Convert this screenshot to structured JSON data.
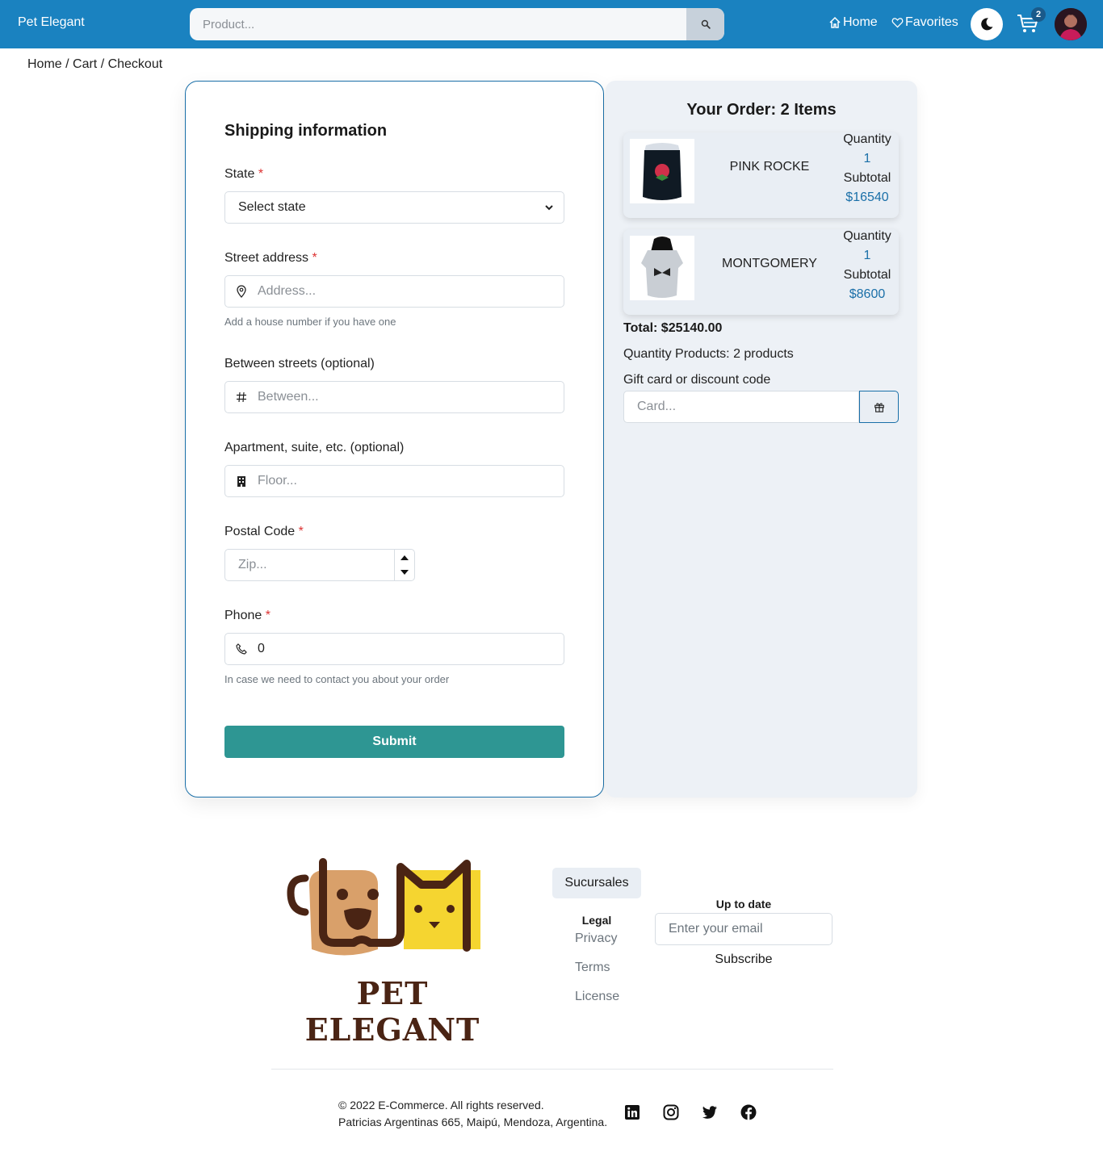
{
  "navbar": {
    "brand": "Pet Elegant",
    "search_placeholder": "Product...",
    "home_label": "Home",
    "favorites_label": "Favorites",
    "cart_count": "2"
  },
  "breadcrumb": "Home / Cart / Checkout",
  "shipping": {
    "title": "Shipping information",
    "state_label": "State",
    "state_value": "Select state",
    "street_label": "Street address",
    "street_placeholder": "Address...",
    "street_hint": "Add a house number if you have one",
    "between_label": "Between streets (optional)",
    "between_placeholder": "Between...",
    "apartment_label": "Apartment, suite, etc. (optional)",
    "apartment_placeholder": "Floor...",
    "postal_label": "Postal Code",
    "postal_placeholder": "Zip...",
    "phone_label": "Phone",
    "phone_value": "0",
    "phone_hint": "In case we need to contact you about your order",
    "required_mark": "*",
    "submit_label": "Submit"
  },
  "order": {
    "title": "Your Order: 2 Items",
    "items": [
      {
        "name": "PINK ROCKE",
        "quantity_label": "Quantity",
        "quantity": "1",
        "subtotal_label": "Subtotal",
        "subtotal": "$16540"
      },
      {
        "name": "MONTGOMERY",
        "quantity_label": "Quantity",
        "quantity": "1",
        "subtotal_label": "Subtotal",
        "subtotal": "$8600"
      }
    ],
    "total": "Total: $25140.00",
    "quantity_products": "Quantity Products: 2 products",
    "gift_label": "Gift card or discount code",
    "gift_placeholder": "Card..."
  },
  "footer": {
    "logo_text": "PET ELEGANT",
    "branches_button": "Sucursales",
    "legal_heading": "Legal",
    "links": [
      "Privacy",
      "Terms",
      "License"
    ],
    "newsletter_heading": "Up to date",
    "email_placeholder": "Enter your email",
    "subscribe_label": "Subscribe",
    "copyright": "© 2022 E-Commerce. All rights reserved.",
    "address": "Patricias Argentinas 665, Maipú, Mendoza, Argentina.",
    "social_icons": [
      "linkedin-icon",
      "instagram-icon",
      "twitter-icon",
      "facebook-icon"
    ]
  },
  "colors": {
    "navbar": "#1a82c0",
    "accent": "#1a6fa8",
    "submit": "#2e9693",
    "panel": "#edf1f6",
    "required": "#dd3333"
  }
}
